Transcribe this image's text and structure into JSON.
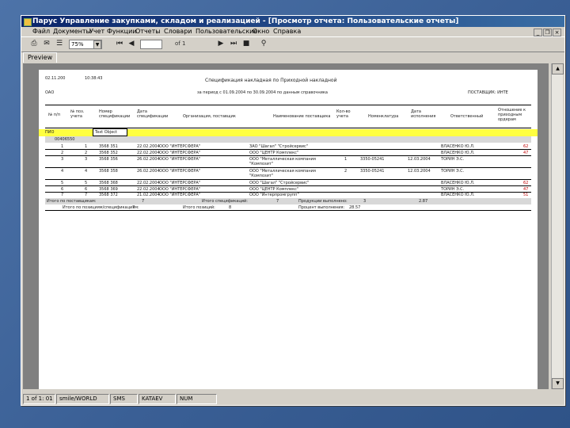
{
  "window": {
    "title": "Парус Управление закупками, складом и реализацией - [Просмотр отчета: Пользовательские отчеты]"
  },
  "menubar": {
    "items": [
      "Файл",
      "Документы",
      "Учет",
      "Функции",
      "Отчеты",
      "Словари",
      "Пользовательские",
      "Окно",
      "Справка"
    ]
  },
  "mdi": {
    "minimize": "_",
    "restore": "❐",
    "close": "×"
  },
  "toolbar": {
    "zoom_value": "75%",
    "page_of": "of 1"
  },
  "tab": {
    "label": "Preview"
  },
  "report": {
    "date": "02.11.200",
    "time": "10:38:43",
    "title": "Спецификация накладная по Приходной накладной",
    "org": "ОАО",
    "period": "за период с 01.09.2004 по 30.09.2004   по данным справочника",
    "supplier": "ПОСТАВЩИК: ИНТЕ",
    "columns": [
      "№ п/п",
      "№ поз. учета",
      "Номер спецификации",
      "Дата спецификации",
      "Организация, поставщик",
      "Наименование поставщика",
      "Кол-во учета",
      "Номенклатура",
      "Дата исполнения",
      "Ответственный",
      "Отношение к приходным ордерам"
    ],
    "group_label": "ПИО",
    "text_object": "Text Object",
    "subgroup": "00406550",
    "rows": [
      {
        "n": "1",
        "pos": "1",
        "spec": "3568 351",
        "date": "22.02.2004",
        "org": "ООО \"ИНТЕРСФЕРА\"",
        "name": "ЗАО \"Шагал\" \"Стройсервис\"",
        "qty": "",
        "nomen": "",
        "due": "",
        "resp": "ВЛАСЕНКО Ю.Л.",
        "mark": "62"
      },
      {
        "n": "2",
        "pos": "2",
        "spec": "3568 352",
        "date": "22.02.2004",
        "org": "ООО \"ИНТЕРСФЕРА\"",
        "name": "ООО \"ЦЕНТР Комплекс\"",
        "qty": "",
        "nomen": "",
        "due": "",
        "resp": "ВЛАСЕНКО Ю.Л.",
        "mark": "47"
      },
      {
        "n": "3",
        "pos": "3",
        "spec": "3568 356",
        "date": "26.02.2004",
        "org": "ООО \"ИНТЕРСФЕРА\"",
        "name": "ООО \"Металлическая компания \"Композит\"",
        "qty": "1",
        "nomen": "3350-05241",
        "due": "12.03.2004",
        "resp": "ТОРИН Э.С.",
        "mark": ""
      },
      {
        "n": "4",
        "pos": "4",
        "spec": "3568 358",
        "date": "26.02.2004",
        "org": "ООО \"ИНТЕРСФЕРА\"",
        "name": "ООО \"Металлическая компания \"Композит\"",
        "qty": "2",
        "nomen": "3350-05241",
        "due": "12.03.2004",
        "resp": "ТОРИН Э.С.",
        "mark": ""
      },
      {
        "n": "5",
        "pos": "5",
        "spec": "3568 368",
        "date": "22.02.2004",
        "org": "ООО \"ИНТЕРСФЕРА\"",
        "name": "ООО \"Шагал\" \"Стройсервис\"",
        "qty": "",
        "nomen": "",
        "due": "",
        "resp": "ВЛАСЕНКО Ю.Л.",
        "mark": "62"
      },
      {
        "n": "6",
        "pos": "6",
        "spec": "3568 369",
        "date": "22.02.2004",
        "org": "ООО \"ИНТЕРСФЕРА\"",
        "name": "ООО \"ЦЕНТР Комплекс\"",
        "qty": "",
        "nomen": "",
        "due": "",
        "resp": "ТОРИН Э.С.",
        "mark": "47"
      },
      {
        "n": "7",
        "pos": "7",
        "spec": "3568 372",
        "date": "21.02.2004",
        "org": "ООО \"ИНТЕРСФЕРА\"",
        "name": "ООО \"Интерпромгрупп\"",
        "qty": "",
        "nomen": "",
        "due": "",
        "resp": "ВЛАСЕНКО Ю.Л.",
        "mark": "51"
      }
    ],
    "total1_label": "Итого по поставщикам:",
    "total1_count": "7",
    "total1b_label": "Итого спецификаций:",
    "total1b_count": "7",
    "total1c_label": "Продукции выполнено:",
    "total1c_val": "3",
    "total1d": "2.87",
    "total2_label": "Итого по позициям/спецификациям:",
    "total2_count": "7",
    "total2b_label": "Итого позиций:",
    "total2b_count": "8",
    "total2c_label": "Процент выполнения:",
    "total2c_val": "28.57"
  },
  "status": {
    "p1": "1 of 1: 01",
    "p2": "smile/WORLD",
    "p3": "SMS",
    "p4": "KATAEV",
    "p5": "NUM"
  }
}
